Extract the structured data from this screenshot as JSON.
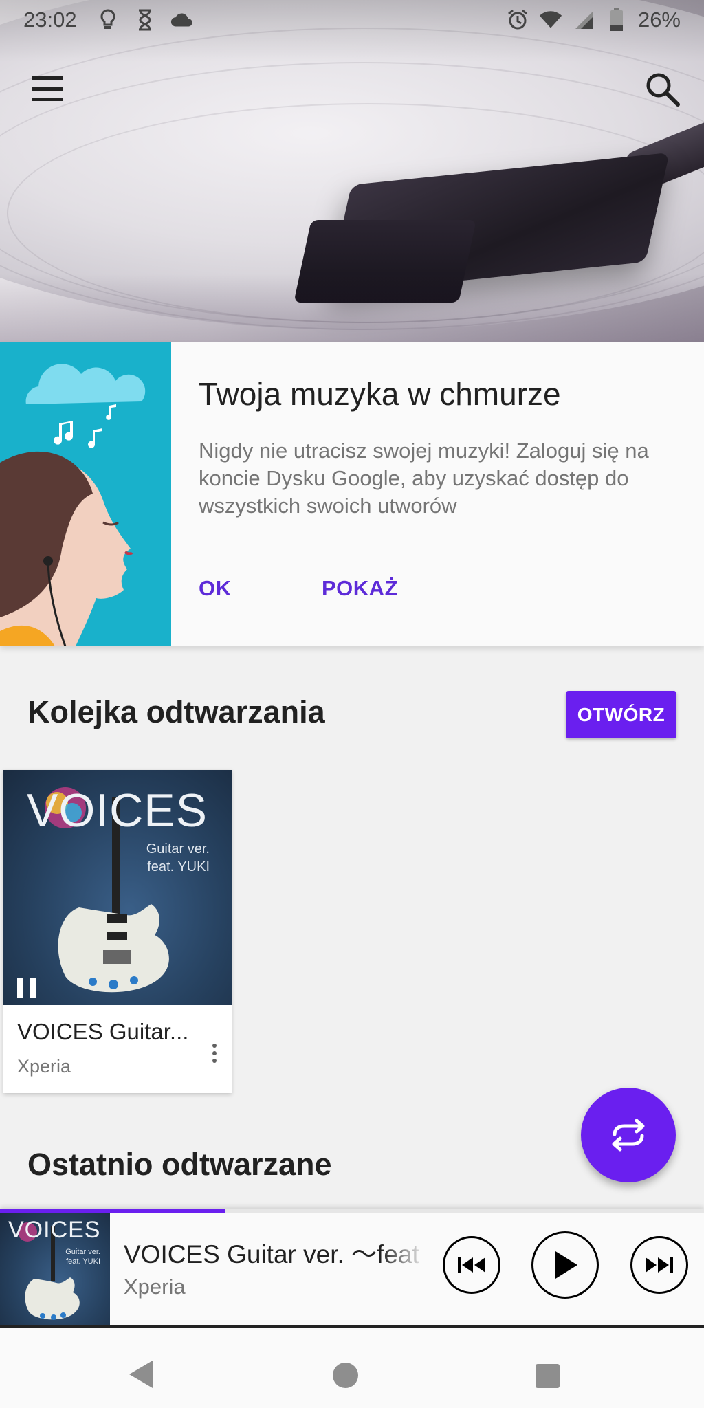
{
  "status_bar": {
    "time": "23:02",
    "battery": "26%",
    "left_icons": [
      "lightbulb-icon",
      "hourglass-icon",
      "cloud-icon"
    ],
    "right_icons": [
      "alarm-icon",
      "wifi-icon",
      "signal-icon",
      "battery-icon"
    ]
  },
  "header": {
    "menu_icon": "hamburger-menu-icon",
    "search_icon": "search-icon"
  },
  "promo": {
    "title": "Twoja muzyka w chmurze",
    "body": "Nigdy nie utracisz swojej muzyki! Zaloguj się na koncie Dysku Google, aby uzyskać dostęp do wszystkich swoich utworów",
    "ok_label": "OK",
    "show_label": "POKAŻ"
  },
  "queue": {
    "title": "Kolejka odtwarzania",
    "open_label": "OTWÓRZ",
    "album": {
      "cover_title": "VOICES",
      "cover_subtitle_line1": "Guitar ver.",
      "cover_subtitle_line2": "feat. YUKI",
      "name": "VOICES Guitar...",
      "artist": "Xperia"
    }
  },
  "recent": {
    "title": "Ostatnio odtwarzane"
  },
  "mini_player": {
    "track": "VOICES Guitar ver. ～feat",
    "artist": "Xperia",
    "progress": 0.32,
    "cover_title": "VOICES",
    "cover_subtitle_line1": "Guitar ver.",
    "cover_subtitle_line2": "feat. YUKI"
  },
  "colors": {
    "accent": "#6a1fef",
    "promo_text_accent": "#5d2bd8",
    "promo_art_bg": "#19b1cb"
  }
}
